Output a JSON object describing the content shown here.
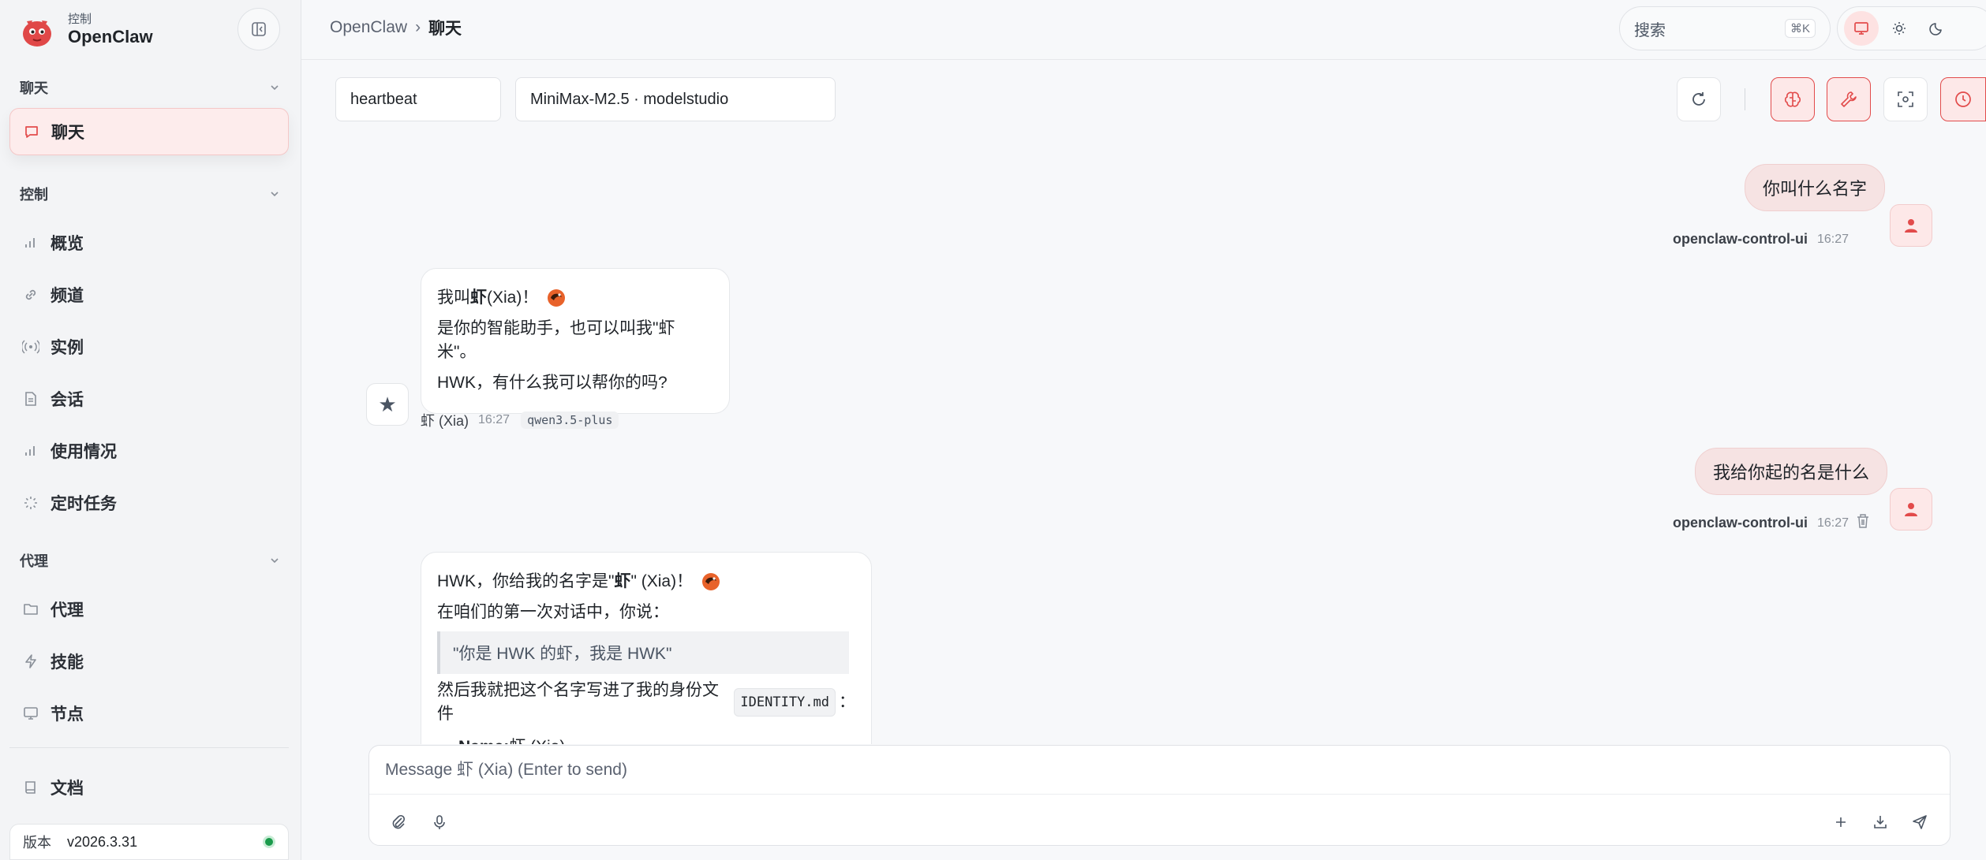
{
  "app": {
    "subtitle": "控制",
    "name": "OpenClaw"
  },
  "breadcrumb": {
    "root": "OpenClaw",
    "sep": "›",
    "current": "聊天"
  },
  "search": {
    "label": "搜索",
    "shortcut": "⌘K"
  },
  "sidebar": {
    "sections": [
      {
        "label": "聊天"
      },
      {
        "label": "控制"
      },
      {
        "label": "代理"
      }
    ],
    "items": {
      "chat": "聊天",
      "overview": "概览",
      "channels": "频道",
      "instances": "实例",
      "sessions": "会话",
      "usage": "使用情况",
      "cron": "定时任务",
      "agents": "代理",
      "skills": "技能",
      "nodes": "节点",
      "docs": "文档"
    },
    "version": {
      "label": "版本",
      "value": "v2026.3.31",
      "status_color": "#1a9a4b"
    }
  },
  "chat": {
    "session": "heartbeat",
    "model": "MiniMax-M2.5 · modelstudio",
    "messages": {
      "u1": {
        "text": "你叫什么名字",
        "sender": "openclaw-control-ui",
        "time": "16:27"
      },
      "b1": {
        "line1_prefix": "我叫",
        "line1_bold": "虾",
        "line1_suffix": " (Xia)！",
        "line2": "是你的智能助手，也可以叫我\"虾米\"。",
        "line3": "HWK，有什么我可以帮你的吗?",
        "sender": "虾 (Xia)",
        "time": "16:27",
        "model": "qwen3.5-plus"
      },
      "u2": {
        "text": "我给你起的名是什么",
        "sender": "openclaw-control-ui",
        "time": "16:27"
      },
      "b2": {
        "line1_prefix": "HWK，你给我的名字是\"",
        "line1_bold": "虾",
        "line1_suffix": "\" (Xia)！",
        "line2": "在咱们的第一次对话中，你说：",
        "quote": "\"你是 HWK 的虾，我是 HWK\"",
        "line3_prefix": "然后我就把这个名字写进了我的身份文件",
        "line3_code": "IDENTITY.md",
        "line3_suffix": "：",
        "li_bold": "Name:",
        "li_text": " 虾 (Xia)"
      }
    },
    "composer_placeholder": "Message 虾 (Xia) (Enter to send)"
  },
  "colors": {
    "accent": "#e24b4b",
    "accent_bg": "#fde8e8"
  }
}
